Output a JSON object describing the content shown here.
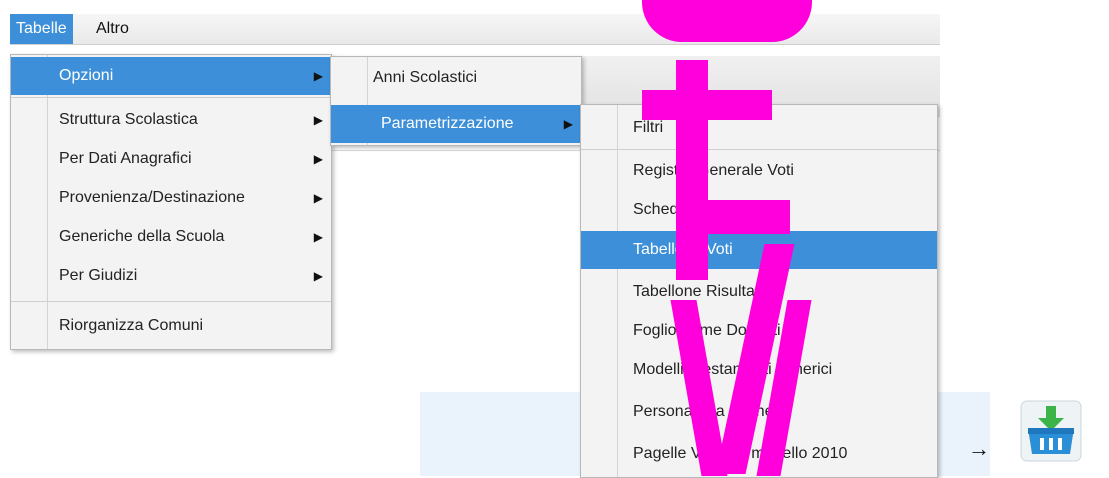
{
  "menubar": {
    "items": [
      "Tabelle",
      "Altro"
    ]
  },
  "menu1": {
    "items": [
      {
        "label": "Opzioni",
        "submenu": true,
        "selected": true
      },
      {
        "label": "Struttura Scolastica",
        "submenu": true
      },
      {
        "label": "Per Dati Anagrafici",
        "submenu": true
      },
      {
        "label": "Provenienza/Destinazione",
        "submenu": true
      },
      {
        "label": "Generiche della Scuola",
        "submenu": true
      },
      {
        "label": "Per Giudizi",
        "submenu": true
      },
      {
        "label": "Riorganizza Comuni",
        "submenu": false
      }
    ]
  },
  "menu2": {
    "items": [
      {
        "label": "Anni Scolastici",
        "submenu": false
      },
      {
        "label": "Parametrizzazione",
        "submenu": true,
        "selected": true
      }
    ]
  },
  "menu3": {
    "items": [
      {
        "label": "Filtri"
      },
      {
        "label": "Registro Generale Voti"
      },
      {
        "label": "Scheda di Religione"
      },
      {
        "label": "Tabellone Voti",
        "selected": true
      },
      {
        "label": "Tabellone Risultati"
      },
      {
        "label": "Foglio Firme Docenti"
      },
      {
        "label": "Modelli prestampati generici"
      },
      {
        "label": "Personalizza Etichette"
      },
      {
        "label": "Pagelle Vecchio modello 2010"
      }
    ]
  },
  "arrow_glyph": "→",
  "icons": {
    "submenu_arrow": "▶",
    "basket": "shopping-basket-download-icon"
  },
  "colors": {
    "selection": "#3c8fd8",
    "watermark": "#ff00dc"
  }
}
